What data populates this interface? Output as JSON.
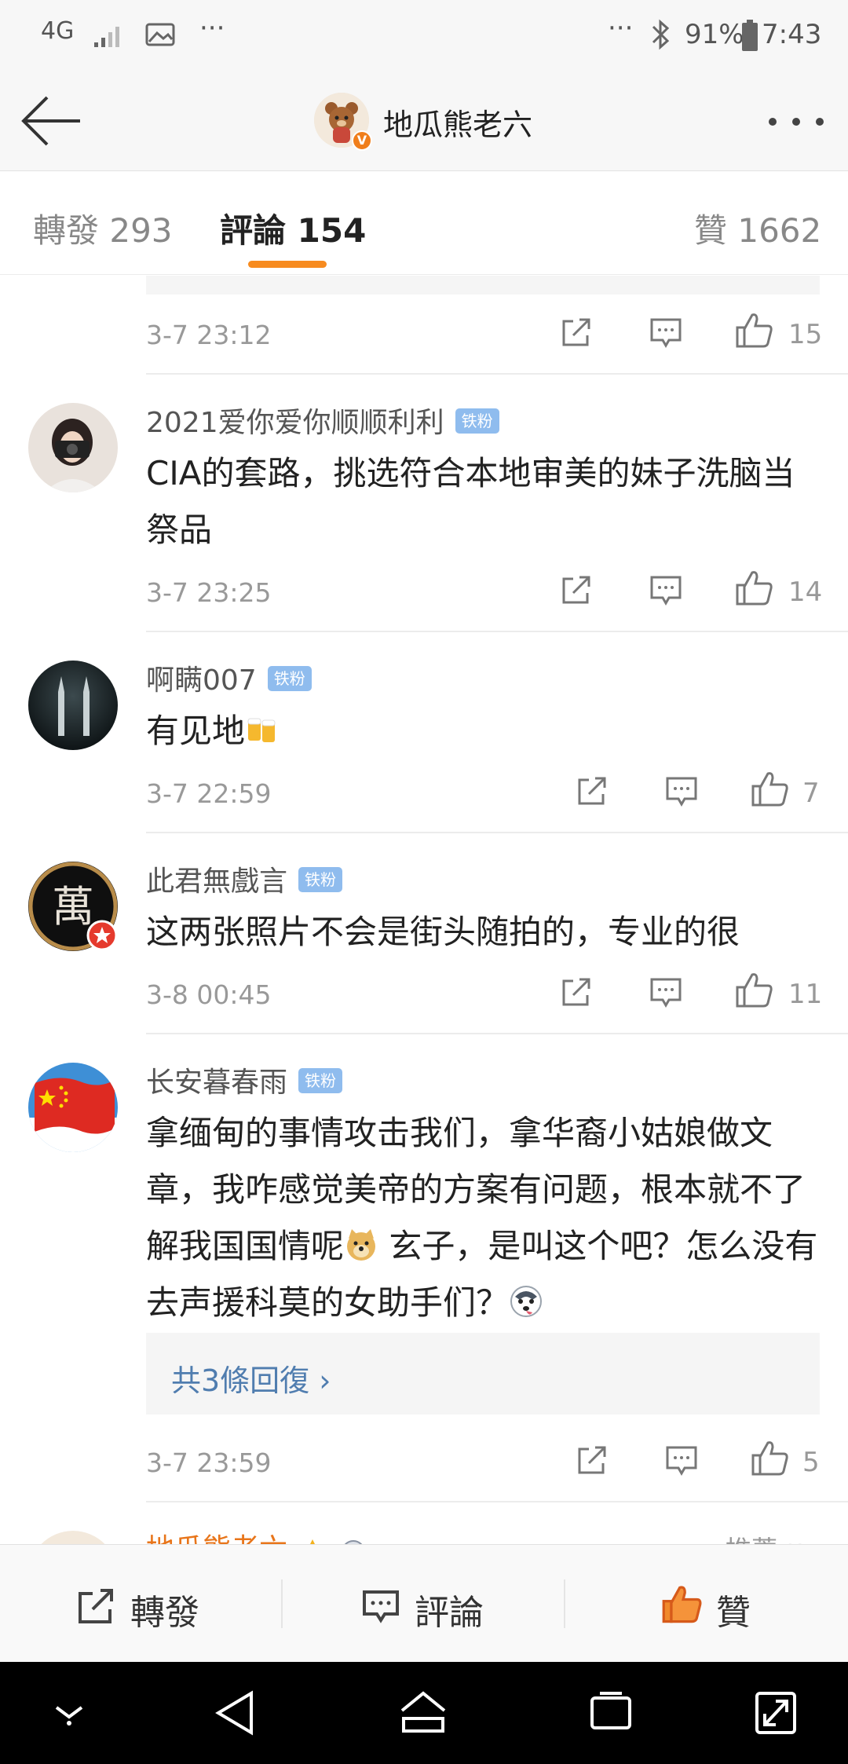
{
  "status_bar": {
    "network": "4G",
    "dots_left": "···",
    "dots_right": "···",
    "battery": "91%",
    "time": "7:43"
  },
  "header": {
    "title": "地瓜熊老六",
    "badge": "V"
  },
  "tabs": [
    {
      "label": "轉發 293"
    },
    {
      "label": "評論 154"
    },
    {
      "label": "贊 1662"
    }
  ],
  "comments": [
    {
      "time": "3-7 23:12",
      "likes": "15"
    },
    {
      "user": "2021爱你爱你顺顺利利",
      "badge": "铁粉",
      "text": "CIA的套路，挑选符合本地审美的妹子洗脑当祭品",
      "time": "3-7 23:25",
      "likes": "14"
    },
    {
      "user": "啊瞒007",
      "badge": "铁粉",
      "text": "有见地",
      "time": "3-7 22:59",
      "likes": "7"
    },
    {
      "user": "此君無戲言",
      "badge": "铁粉",
      "avatar_char": "萬",
      "text": "这两张照片不会是街头随拍的，专业的很",
      "time": "3-8 00:45",
      "likes": "11"
    },
    {
      "user": "长安暮春雨",
      "badge": "铁粉",
      "text_a": "拿缅甸的事情攻击我们，拿华裔小姑娘做文章，我咋感觉美帝的方案有问题，根本就不了解我国国情呢",
      "text_b": " 玄子，是叫这个吧？怎么没有去声援科莫的女助手们？",
      "replies": "共3條回復 ›",
      "time": "3-7 23:59",
      "likes": "5"
    },
    {
      "user": "地瓜熊老六",
      "sort": "推薦 ∨"
    }
  ],
  "bottom_bar": {
    "repost": "轉發",
    "comment": "評論",
    "like": "贊"
  },
  "colors": {
    "accent": "#f78b1f",
    "link": "#507daf",
    "fan_badge": "#8fbcee"
  }
}
